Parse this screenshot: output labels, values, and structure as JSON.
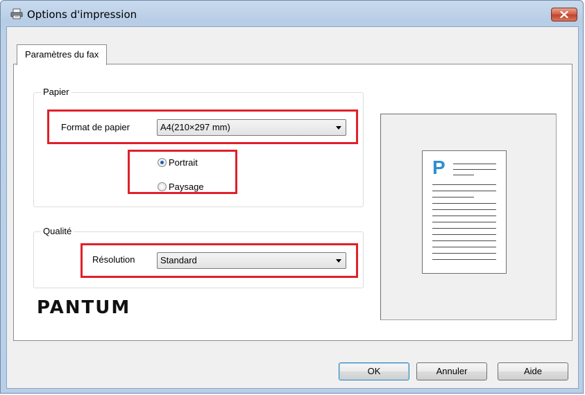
{
  "window": {
    "title": "Options d'impression",
    "icons": {
      "title": "printer-icon",
      "close": "close-icon"
    }
  },
  "tabs": [
    {
      "label": "Paramètres du fax",
      "active": true
    }
  ],
  "paper": {
    "group_label": "Papier",
    "format_label": "Format de papier",
    "format_value": "A4(210×297 mm)",
    "orientation_options": [
      {
        "label": "Portrait",
        "checked": true
      },
      {
        "label": "Paysage",
        "checked": false
      }
    ]
  },
  "quality": {
    "group_label": "Qualité",
    "resolution_label": "Résolution",
    "resolution_value": "Standard"
  },
  "preview": {
    "letter": "P"
  },
  "brand": {
    "logo_text": "PANTUM"
  },
  "buttons": {
    "ok": "OK",
    "cancel": "Annuler",
    "help": "Aide"
  },
  "colors": {
    "highlight": "#e0202a",
    "preview_accent": "#2f8fd1",
    "close_button": "#c5432a"
  }
}
